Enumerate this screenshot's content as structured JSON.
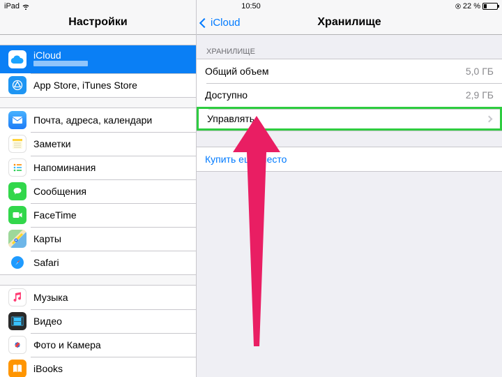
{
  "statusbar": {
    "device": "iPad",
    "time": "10:50",
    "battery_text": "22 %",
    "orientation_locked": true
  },
  "sidebar": {
    "title": "Настройки",
    "groups": [
      {
        "items": [
          {
            "id": "icloud",
            "label": "iCloud",
            "subtitle_redacted": true,
            "icon": "cloud",
            "selected": true
          },
          {
            "id": "stores",
            "label": "App Store, iTunes Store",
            "icon": "appstore"
          }
        ]
      },
      {
        "items": [
          {
            "id": "mail",
            "label": "Почта, адреса, календари",
            "icon": "mail"
          },
          {
            "id": "notes",
            "label": "Заметки",
            "icon": "notes"
          },
          {
            "id": "reminders",
            "label": "Напоминания",
            "icon": "reminders"
          },
          {
            "id": "messages",
            "label": "Сообщения",
            "icon": "messages"
          },
          {
            "id": "facetime",
            "label": "FaceTime",
            "icon": "facetime"
          },
          {
            "id": "maps",
            "label": "Карты",
            "icon": "maps"
          },
          {
            "id": "safari",
            "label": "Safari",
            "icon": "safari"
          }
        ]
      },
      {
        "items": [
          {
            "id": "music",
            "label": "Музыка",
            "icon": "music"
          },
          {
            "id": "video",
            "label": "Видео",
            "icon": "video"
          },
          {
            "id": "photos",
            "label": "Фото и Камера",
            "icon": "photos"
          },
          {
            "id": "ibooks",
            "label": "iBooks",
            "icon": "ibooks"
          }
        ]
      }
    ]
  },
  "detail": {
    "back_label": "iCloud",
    "title": "Хранилище",
    "section": {
      "header": "ХРАНИЛИЩЕ",
      "rows": [
        {
          "id": "total",
          "label": "Общий объем",
          "value": "5,0 ГБ"
        },
        {
          "id": "available",
          "label": "Доступно",
          "value": "2,9 ГБ"
        },
        {
          "id": "manage",
          "label": "Управлять",
          "disclosure": true,
          "highlighted": true
        }
      ]
    },
    "buy_more": "Купить еще место"
  },
  "icon_colors": {
    "cloud": "#ffffff",
    "appstore": "#1e95f3",
    "mail": "#1f7cf6",
    "notes": "#ffd33a",
    "reminders": "#ffffff",
    "messages": "#32d74b",
    "facetime": "#32d74b",
    "maps": "#6db6e8",
    "safari": "#1f9bff",
    "music": "#ff3b73",
    "video": "#2a2a2a",
    "photos": "#fff",
    "ibooks": "#ff9500"
  }
}
